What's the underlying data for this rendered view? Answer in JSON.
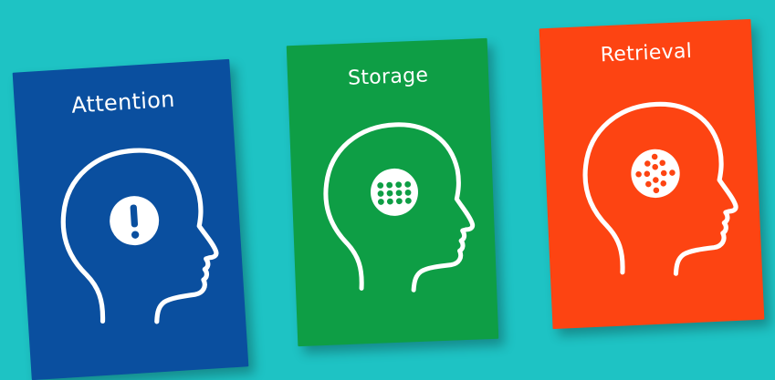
{
  "background_color": "#1ec3c4",
  "cards": [
    {
      "title": "Attention",
      "color": "#0a4f9f",
      "icon": "head-with-exclamation-icon"
    },
    {
      "title": "Storage",
      "color": "#0e9e45",
      "icon": "head-with-dot-grid-icon"
    },
    {
      "title": "Retrieval",
      "color": "#fd4412",
      "icon": "head-with-dot-diamond-icon"
    }
  ]
}
